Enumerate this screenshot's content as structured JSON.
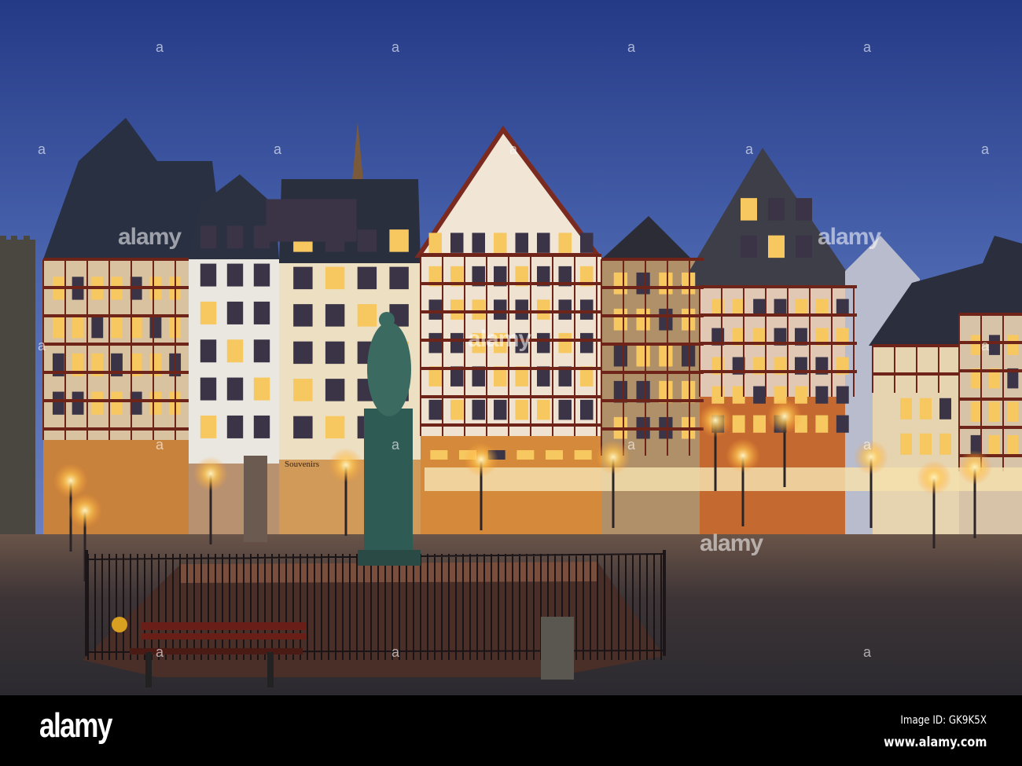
{
  "photo": {
    "sign_text": "Souvenirs",
    "colors": {
      "sky_top": "#2a3f8c",
      "sky_bottom": "#5570b8",
      "lamp_glow": "#ffcf6a",
      "timber": "#7a2a1e",
      "plaster": "#efe6d6",
      "slate_roof": "#2a3040",
      "cobblestone": "#3b3438"
    }
  },
  "watermark": {
    "overlay_text": "alamy",
    "logo": "alamy",
    "image_id": "Image ID: GK9K5X",
    "url": "www.alamy.com"
  }
}
